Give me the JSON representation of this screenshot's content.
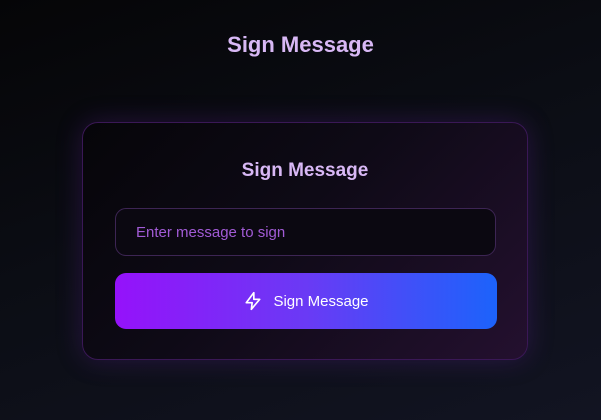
{
  "page": {
    "title": "Sign Message"
  },
  "card": {
    "title": "Sign Message",
    "input": {
      "value": "",
      "placeholder": "Enter message to sign"
    },
    "button": {
      "label": "Sign Message",
      "icon": "bolt-icon"
    }
  },
  "colors": {
    "title_text": "#d8b8f5",
    "placeholder_text": "#a25bd6",
    "button_gradient_start": "#9512fa",
    "button_gradient_end": "#1c63fb"
  }
}
